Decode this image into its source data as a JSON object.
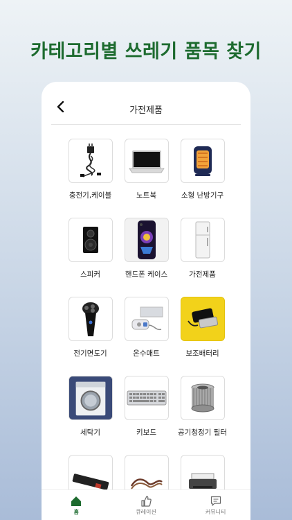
{
  "headline": "카테고리별 쓰레기 품목 찾기",
  "topbar": {
    "title": "가전제품"
  },
  "items": [
    {
      "label": "충전기,케이블",
      "icon": "charger-cable-icon"
    },
    {
      "label": "노트북",
      "icon": "laptop-icon"
    },
    {
      "label": "소형 난방기구",
      "icon": "heater-icon"
    },
    {
      "label": "스피커",
      "icon": "speaker-icon"
    },
    {
      "label": "핸드폰 케이스",
      "icon": "phone-case-icon"
    },
    {
      "label": "가전제품",
      "icon": "refrigerator-icon"
    },
    {
      "label": "전기면도기",
      "icon": "shaver-icon"
    },
    {
      "label": "온수매트",
      "icon": "heating-mat-icon"
    },
    {
      "label": "보조배터리",
      "icon": "power-bank-icon"
    },
    {
      "label": "세탁기",
      "icon": "washing-machine-icon"
    },
    {
      "label": "키보드",
      "icon": "keyboard-icon"
    },
    {
      "label": "공기청정기 필터",
      "icon": "air-filter-icon"
    },
    {
      "label": "",
      "icon": "power-strip-icon"
    },
    {
      "label": "",
      "icon": "cables-icon"
    },
    {
      "label": "",
      "icon": "printer-icon"
    }
  ],
  "tabs": [
    {
      "label": "홈",
      "icon": "home-icon",
      "active": true
    },
    {
      "label": "큐레이션",
      "icon": "thumbs-up-icon",
      "active": false
    },
    {
      "label": "커뮤니티",
      "icon": "chat-icon",
      "active": false
    }
  ],
  "colors": {
    "accent": "#1d6b2f"
  }
}
